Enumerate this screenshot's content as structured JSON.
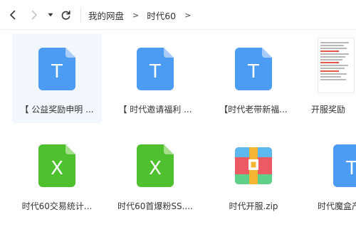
{
  "breadcrumb": {
    "root": "我的网盘",
    "current": "时代60",
    "separator": ">"
  },
  "toolbar": {
    "back_icon": "chevron-left-icon",
    "forward_icon": "chevron-right-icon",
    "history_icon": "caret-down-icon",
    "refresh_icon": "refresh-icon"
  },
  "files": [
    {
      "name": "【 公益奖励申明 ...",
      "type": "txt",
      "icon_letter": "T",
      "color": "#4d9cf4",
      "selected": true
    },
    {
      "name": "【 时代邀请福利 ...",
      "type": "txt",
      "icon_letter": "T",
      "color": "#4d9cf4",
      "selected": false
    },
    {
      "name": "【时代老带新福...",
      "type": "txt",
      "icon_letter": "T",
      "color": "#4d9cf4",
      "selected": false
    },
    {
      "name": "开服奖励",
      "type": "doc",
      "icon_letter": "",
      "color": "#ffffff",
      "selected": false
    },
    {
      "name": "时代60交易统计...",
      "type": "xls",
      "icon_letter": "X",
      "color": "#4fc12f",
      "selected": false
    },
    {
      "name": "时代60首爆粉SS....",
      "type": "xls",
      "icon_letter": "X",
      "color": "#4fc12f",
      "selected": false
    },
    {
      "name": "时代开服.zip",
      "type": "zip",
      "icon_letter": "",
      "color": "#f5b533",
      "selected": false
    },
    {
      "name": "时代魔盒产",
      "type": "txt",
      "icon_letter": "T",
      "color": "#4d9cf4",
      "selected": false
    }
  ]
}
